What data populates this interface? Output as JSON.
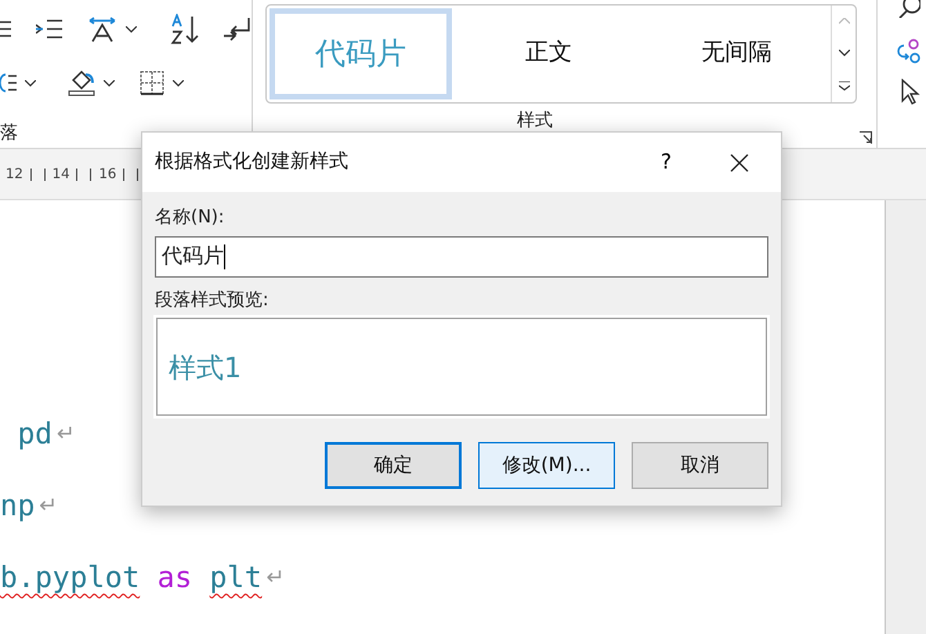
{
  "ribbon": {
    "paragraph_group_label": "落",
    "styles_group_label": "样式",
    "styles": [
      {
        "name": "代码片",
        "selected": true
      },
      {
        "name": "正文",
        "selected": false
      },
      {
        "name": "无间隔",
        "selected": false
      }
    ]
  },
  "ruler": {
    "labels": [
      "12",
      "14",
      "16"
    ]
  },
  "document": {
    "lines": [
      {
        "tokens": [
          {
            "text": " pd",
            "kind": "name",
            "misspelled": false
          }
        ],
        "mark": "↵"
      },
      {
        "tokens": [
          {
            "text": "np",
            "kind": "name",
            "misspelled": false
          }
        ],
        "mark": "↵"
      },
      {
        "tokens": [
          {
            "text": "b.pyplot",
            "kind": "name",
            "misspelled": true
          },
          {
            "text": "as",
            "kind": "keyword",
            "misspelled": false
          },
          {
            "text": "plt",
            "kind": "name",
            "misspelled": true
          }
        ],
        "mark": "↵"
      }
    ]
  },
  "dialog": {
    "title": "根据格式化创建新样式",
    "help": "?",
    "name_label": "名称(N):",
    "name_value": "代码片",
    "preview_label": "段落样式预览:",
    "preview_text": "样式1",
    "buttons": [
      {
        "label": "确定",
        "kind": "default"
      },
      {
        "label": "修改(M)...",
        "kind": "hover"
      },
      {
        "label": "取消",
        "kind": "normal"
      }
    ]
  }
}
